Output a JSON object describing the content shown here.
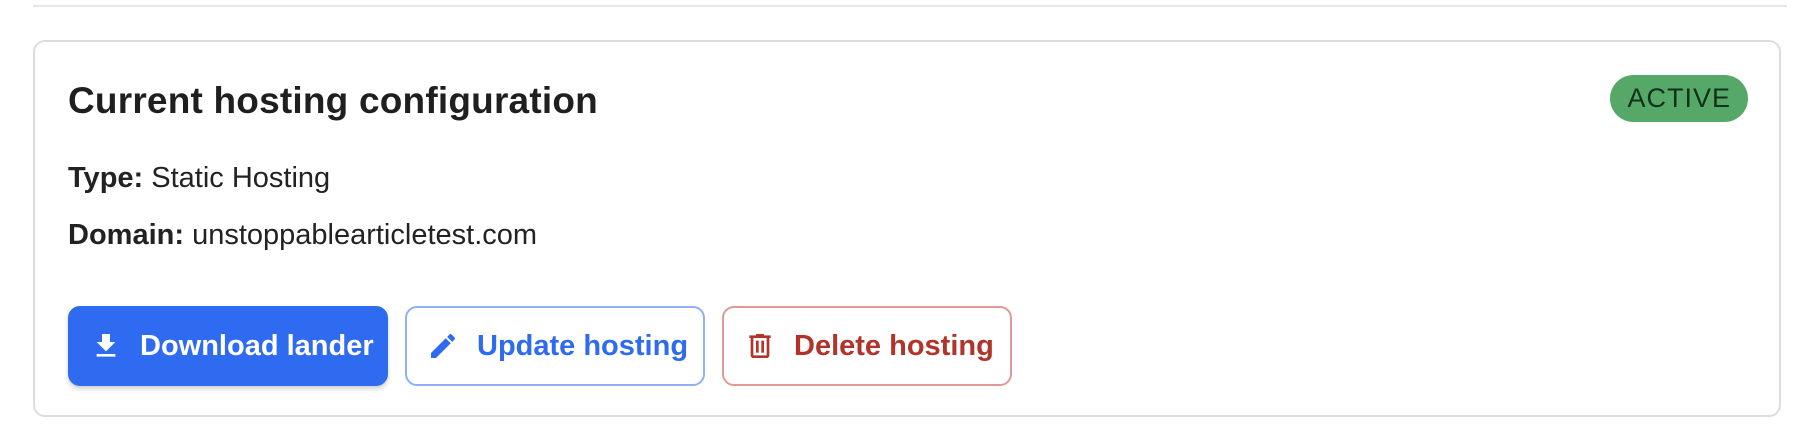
{
  "card": {
    "title": "Current hosting configuration",
    "status_badge": "ACTIVE",
    "type_label": "Type:",
    "type_value": "Static Hosting",
    "domain_label": "Domain:",
    "domain_value": "unstoppablearticletest.com"
  },
  "actions": {
    "download_label": "Download lander",
    "download_icon": "download-icon",
    "update_label": "Update hosting",
    "update_icon": "pencil-icon",
    "delete_label": "Delete hosting",
    "delete_icon": "trash-icon"
  },
  "colors": {
    "primary": "#2f6bf0",
    "danger": "#b2332a",
    "active_badge": "#55a868"
  }
}
